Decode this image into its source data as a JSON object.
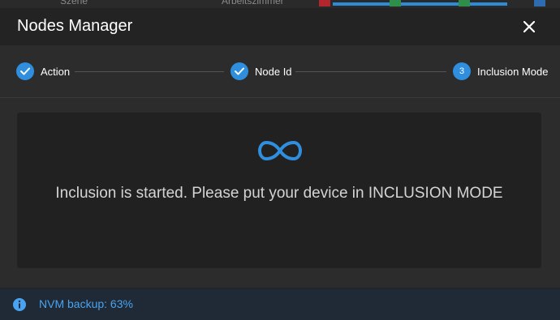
{
  "background": {
    "items": [
      "Szene",
      "Arbeitszimmer"
    ]
  },
  "dialog": {
    "title": "Nodes Manager",
    "close_icon": "close-icon"
  },
  "stepper": {
    "steps": [
      {
        "label": "Action",
        "state": "completed",
        "icon": "check-icon"
      },
      {
        "label": "Node Id",
        "state": "completed",
        "icon": "check-icon"
      },
      {
        "label": "Inclusion Mode",
        "state": "active",
        "number": "3"
      }
    ]
  },
  "content": {
    "icon": "infinity-icon",
    "message": "Inclusion is started. Please put your device in INCLUSION MODE"
  },
  "status": {
    "icon": "info-icon",
    "text": "NVM backup: 63%"
  },
  "colors": {
    "accent": "#2f8fde",
    "dialog_bg": "#2c2c2c",
    "header_bg": "#232323",
    "content_bg": "#212121",
    "status_bg": "#1f2a36",
    "status_text": "#4aa3f0"
  }
}
